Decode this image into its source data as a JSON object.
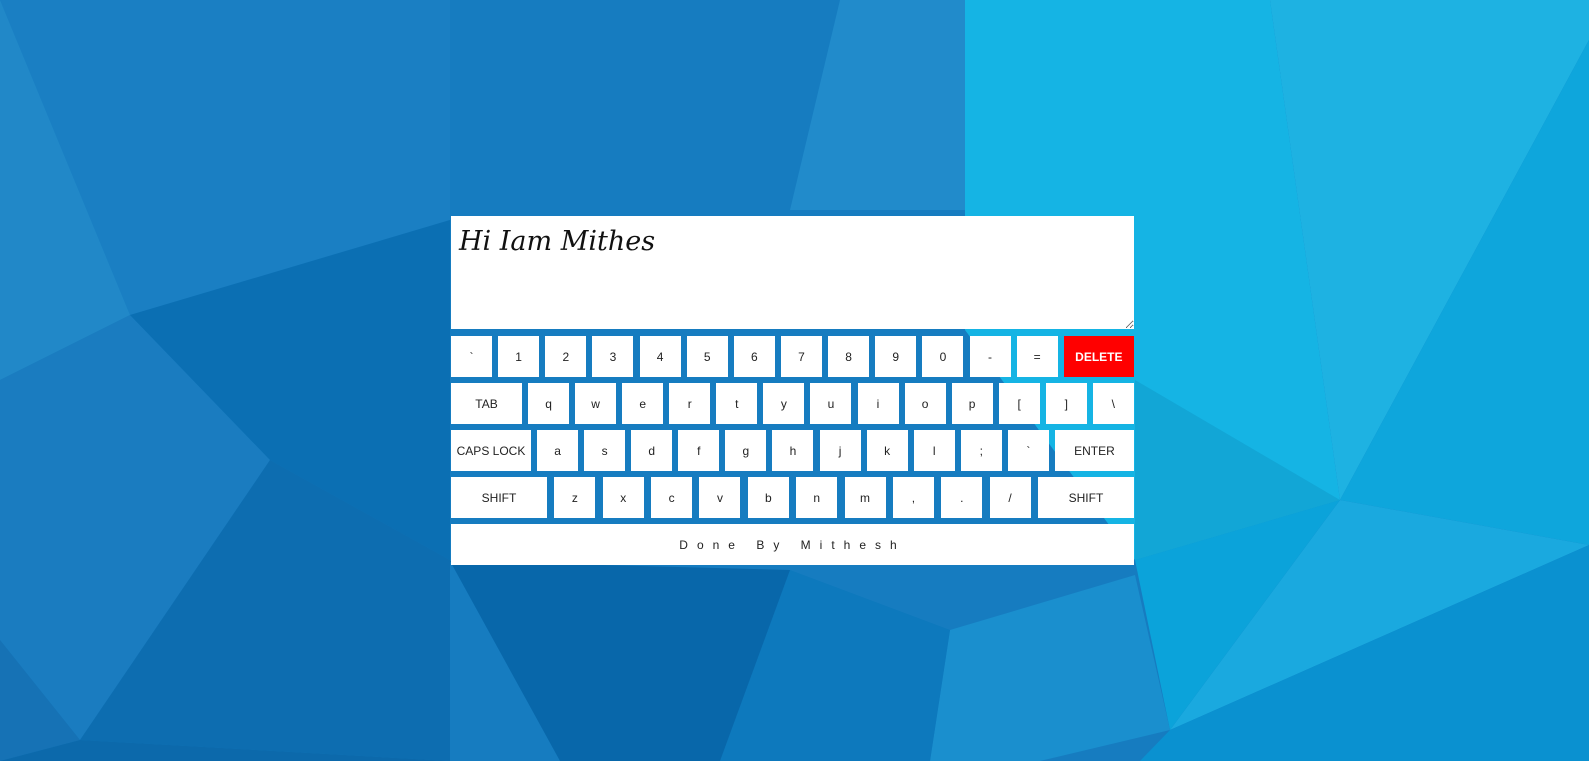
{
  "textarea": {
    "value": "Hi Iam Mithes"
  },
  "keyboard": {
    "row1": [
      "`",
      "1",
      "2",
      "3",
      "4",
      "5",
      "6",
      "7",
      "8",
      "9",
      "0",
      "-",
      "=",
      "DELETE"
    ],
    "row2": [
      "TAB",
      "q",
      "w",
      "e",
      "r",
      "t",
      "y",
      "u",
      "i",
      "o",
      "p",
      "[",
      "]",
      "\\"
    ],
    "row3": [
      "CAPS LOCK",
      "a",
      "s",
      "d",
      "f",
      "g",
      "h",
      "j",
      "k",
      "l",
      ";",
      "`",
      "ENTER"
    ],
    "row4": [
      "SHIFT",
      "z",
      "x",
      "c",
      "v",
      "b",
      "n",
      "m",
      ",",
      ".",
      "/",
      "SHIFT"
    ]
  },
  "footer": {
    "text": "Done By Mithesh"
  },
  "colors": {
    "background": "#1579be",
    "key": "#ffffff",
    "delete_key": "#ff0000"
  }
}
